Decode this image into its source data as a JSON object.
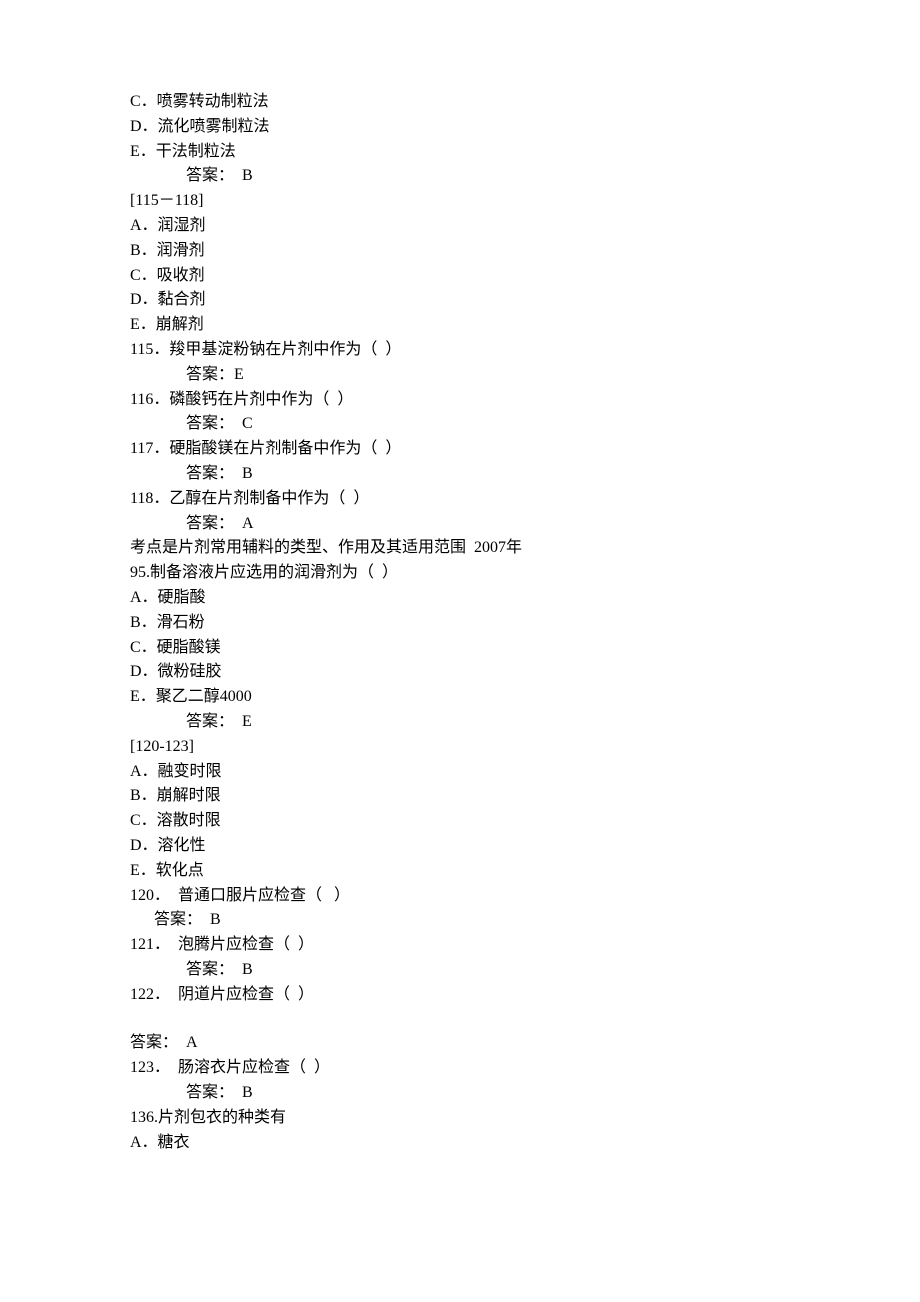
{
  "lines": [
    {
      "cls": "",
      "text": "C．喷雾转动制粒法"
    },
    {
      "cls": "",
      "text": "D．流化喷雾制粒法"
    },
    {
      "cls": "",
      "text": "E．干法制粒法"
    },
    {
      "cls": "indent1",
      "text": "答案：  B"
    },
    {
      "cls": "",
      "text": "[115－118]"
    },
    {
      "cls": "",
      "text": "A．润湿剂"
    },
    {
      "cls": "",
      "text": "B．润滑剂"
    },
    {
      "cls": "",
      "text": "C．吸收剂"
    },
    {
      "cls": "",
      "text": "D．黏合剂"
    },
    {
      "cls": "",
      "text": "E．崩解剂"
    },
    {
      "cls": "",
      "text": "115．羧甲基淀粉钠在片剂中作为（  ）"
    },
    {
      "cls": "indent1",
      "text": "答案：E"
    },
    {
      "cls": "",
      "text": "116．磷酸钙在片剂中作为（  ）"
    },
    {
      "cls": "indent1",
      "text": "答案：  C"
    },
    {
      "cls": "",
      "text": "117．硬脂酸镁在片剂制备中作为（  ）"
    },
    {
      "cls": "indent1",
      "text": "答案：  B"
    },
    {
      "cls": "",
      "text": "118．乙醇在片剂制备中作为（  ）"
    },
    {
      "cls": "indent1",
      "text": "答案：  A"
    },
    {
      "cls": "",
      "text": "考点是片剂常用辅料的类型、作用及其适用范围  2007年"
    },
    {
      "cls": "",
      "text": "95.制备溶液片应选用的润滑剂为（  ）"
    },
    {
      "cls": "",
      "text": "A．硬脂酸"
    },
    {
      "cls": "",
      "text": "B．滑石粉"
    },
    {
      "cls": "",
      "text": "C．硬脂酸镁"
    },
    {
      "cls": "",
      "text": "D．微粉硅胶"
    },
    {
      "cls": "",
      "text": "E．聚乙二醇4000"
    },
    {
      "cls": "indent1",
      "text": "答案：  E"
    },
    {
      "cls": "",
      "text": "[120-123]"
    },
    {
      "cls": "",
      "text": "A．融变时限"
    },
    {
      "cls": "",
      "text": "B．崩解时限"
    },
    {
      "cls": "",
      "text": "C．溶散时限"
    },
    {
      "cls": "",
      "text": "D．溶化性"
    },
    {
      "cls": "",
      "text": "E．软化点"
    },
    {
      "cls": "",
      "text": "120．  普通口服片应检查（   ）"
    },
    {
      "cls": "indent-small",
      "text": "答案：  B"
    },
    {
      "cls": "",
      "text": "121．  泡腾片应检查（  ）"
    },
    {
      "cls": "indent1",
      "text": "答案：  B"
    },
    {
      "cls": "",
      "text": "122．  阴道片应检查（  ）"
    },
    {
      "cls": "blank",
      "text": ""
    },
    {
      "cls": "",
      "text": "答案：  A"
    },
    {
      "cls": "",
      "text": "123．  肠溶衣片应检查（  ）"
    },
    {
      "cls": "indent1",
      "text": "答案：  B"
    },
    {
      "cls": "",
      "text": "136.片剂包衣的种类有"
    },
    {
      "cls": "",
      "text": "A．糖衣"
    }
  ]
}
